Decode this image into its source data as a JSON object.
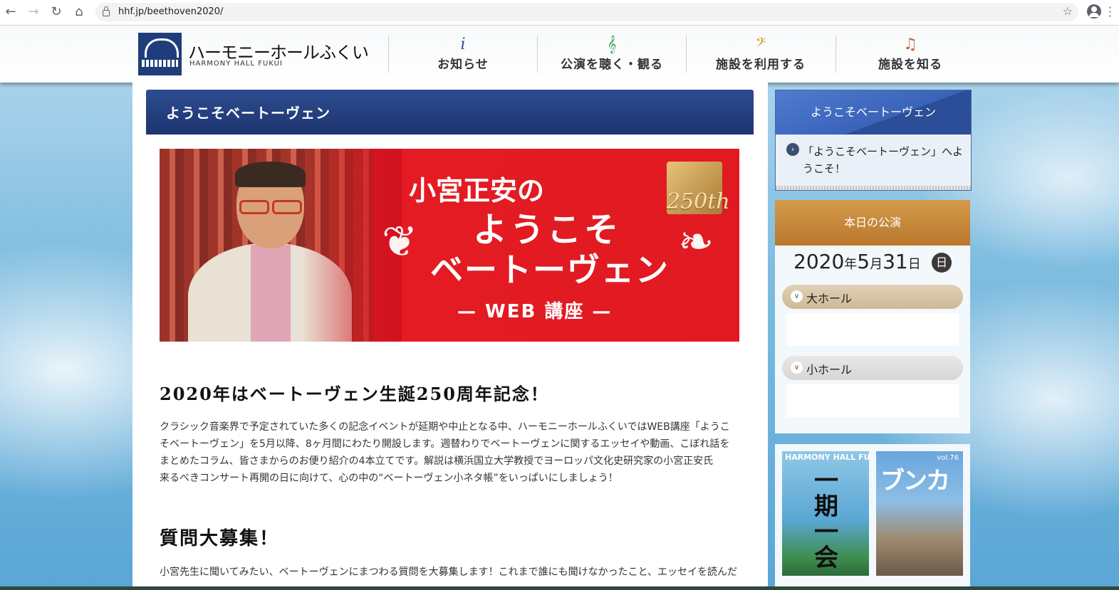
{
  "browser": {
    "url": "hhf.jp/beethoven2020/"
  },
  "header": {
    "logo_name": "ハーモニーホールふくい",
    "logo_sub": "HARMONY HALL FUKUI",
    "nav": [
      {
        "icon": "i",
        "label": "お知らせ"
      },
      {
        "icon": "𝄞",
        "label": "公演を聴く・観る"
      },
      {
        "icon": "𝄢",
        "label": "施設を利用する"
      },
      {
        "icon": "♫",
        "label": "施設を知る"
      }
    ]
  },
  "main": {
    "title": "ようこそベートーヴェン",
    "banner": {
      "line1": "小宮正安の",
      "line2": "ようこそ",
      "line3": "ベートーヴェン",
      "line4": "— WEB 講座 —",
      "badge": "250th"
    },
    "heading1": "2020年はベートーヴェン生誕250周年記念！",
    "paragraph1": [
      "クラシック音楽界で予定されていた多くの記念イベントが延期や中止となる中、ハーモニーホールふくいではWEB講座「ようこ",
      "そベートーヴェン」を5月以降、8ヶ月間にわたり開設します。週替わりでベートーヴェンに関するエッセイや動画、こぼれ話を",
      "まとめたコラム、皆さまからのお便り紹介の4本立てです。解説は横浜国立大学教授でヨーロッパ文化史研究家の小宮正安氏",
      "来るべきコンサート再開の日に向けて、心の中の“ベートーヴェン小ネタ帳”をいっぱいにしましょう！"
    ],
    "heading2": "質問大募集！",
    "paragraph2": "小宮先生に聞いてみたい、ベートーヴェンにまつわる質問を大募集します！これまで誰にも聞けなかったこと、エッセイを読んだ"
  },
  "sidebar": {
    "widget1_title": "ようこそベートーヴェン",
    "widget1_link": "「ようこそベートーヴェン」へようこそ！",
    "widget2_title": "本日の公演",
    "date": {
      "year": "2020",
      "year_unit": "年",
      "month": "5",
      "month_unit": "月",
      "day": "31",
      "day_unit": "日",
      "weekday": "日"
    },
    "halls": [
      {
        "label": "大ホール"
      },
      {
        "label": "小ホール"
      }
    ],
    "mag1_title": "HARMONY HALL FUKUI",
    "mag1_big": "一期一会",
    "mag2_title": "ブンカ",
    "mag2_vol": "vol.76"
  },
  "colors": {
    "title_bar": "#1d3570",
    "banner_red": "#e41b23",
    "gold": "#b9782e"
  }
}
